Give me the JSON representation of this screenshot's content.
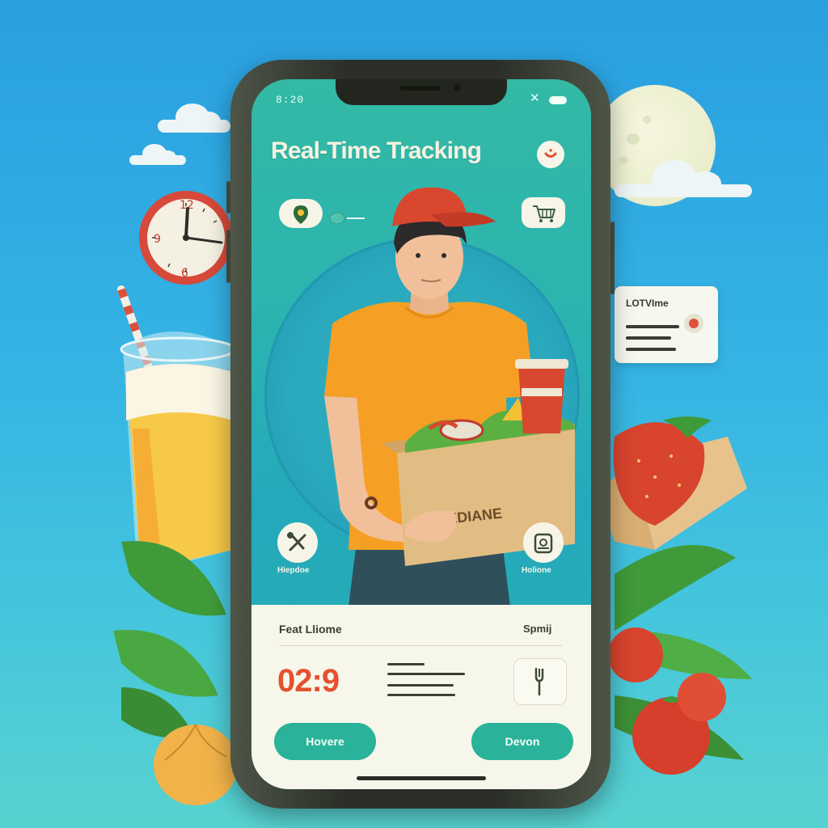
{
  "status_bar": {
    "time": "8:20",
    "close_glyph": "✕"
  },
  "header": {
    "title": "Real-Time Tracking"
  },
  "card": {
    "title": "Feat Lliome",
    "right_label": "Spmij",
    "timer": "02:9",
    "buttons": {
      "left": "Hovere",
      "right": "Devon"
    }
  },
  "quick_actions": {
    "left_label": "Hiepdoe",
    "right_label": "Holione"
  },
  "box_label": "LEEDIANE",
  "side_card": {
    "title": "LOTVIme"
  },
  "colors": {
    "accent_teal": "#2ab39a",
    "timer_red": "#e5512f",
    "sheet_bg": "#f7f6ea",
    "screen_teal": "#2bb3b1"
  },
  "icons": [
    "location-pin-icon",
    "cart-icon",
    "smile-icon",
    "utensils-icon",
    "bag-icon",
    "fork-icon",
    "clock-icon"
  ]
}
